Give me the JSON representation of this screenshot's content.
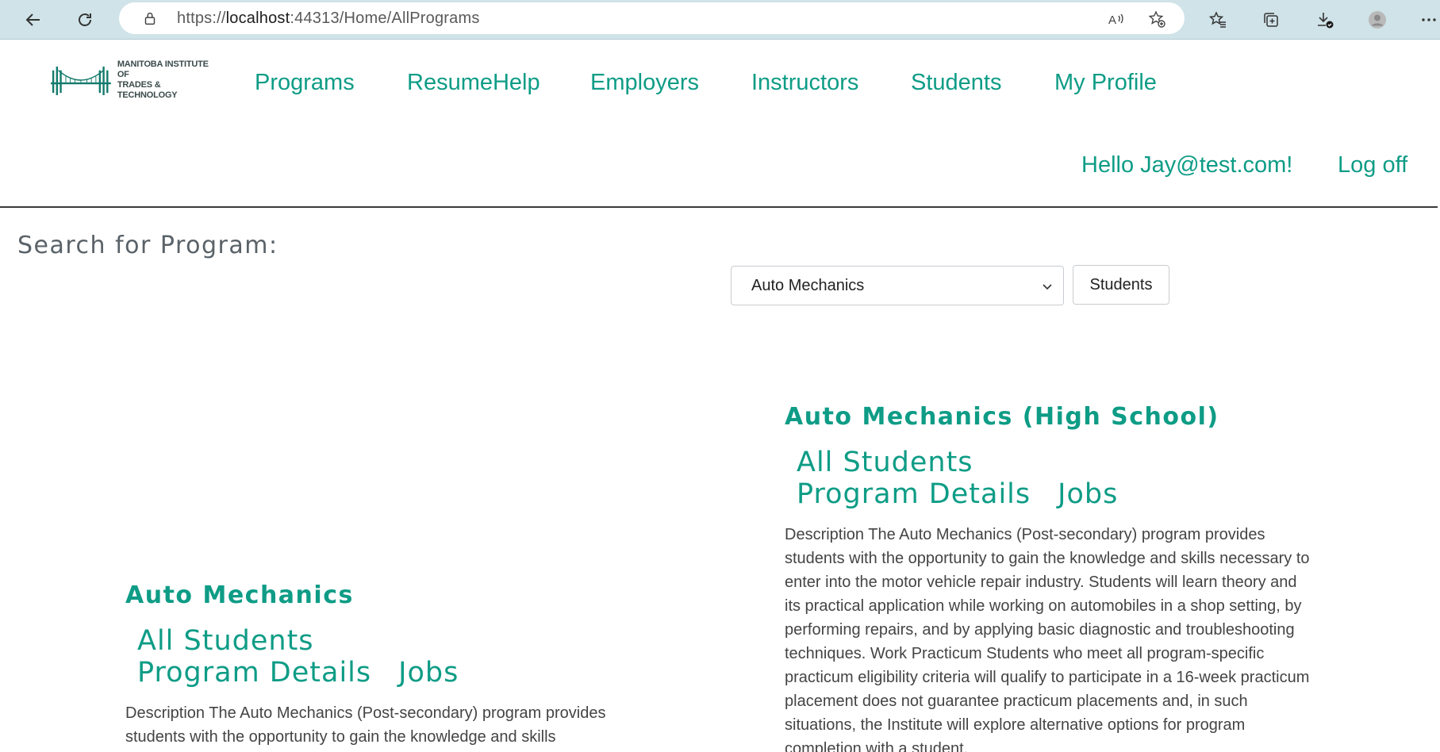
{
  "browser": {
    "url_prefix": "https://",
    "url_host": "localhost",
    "url_rest": ":44313/Home/AllPrograms"
  },
  "logo": {
    "line1": "MANITOBA INSTITUTE OF",
    "line2": "TRADES & TECHNOLOGY"
  },
  "nav": {
    "items": [
      "Programs",
      "ResumeHelp",
      "Employers",
      "Instructors",
      "Students",
      "My Profile"
    ],
    "greeting": "Hello Jay@test.com!",
    "logoff": "Log off"
  },
  "search": {
    "label": "Search for Program:",
    "selected_program": "Auto Mechanics",
    "button_label": "Students"
  },
  "programs": [
    {
      "title": "Auto Mechanics",
      "links": [
        "All Students",
        "Program Details",
        "Jobs"
      ],
      "description": "Description The Auto Mechanics (Post-secondary) program provides students with the opportunity to gain the knowledge and skills"
    },
    {
      "title": "Auto Mechanics (High School)",
      "links": [
        "All Students",
        "Program Details",
        "Jobs"
      ],
      "description": "Description The Auto Mechanics (Post-secondary) program provides students with the opportunity to gain the knowledge and skills necessary to enter into the motor vehicle repair industry. Students will learn theory and its practical application while working on automobiles in a shop setting, by performing repairs, and by applying basic diagnostic and troubleshooting techniques. Work Practicum Students who meet all program-specific practicum eligibility criteria will qualify to participate in a 16-week practicum placement does not guarantee practicum placements and, in such situations, the Institute will explore alternative options for program completion with a student."
    }
  ],
  "colors": {
    "accent": "#0e9c86",
    "browser_bar": "#cfe3e8"
  }
}
